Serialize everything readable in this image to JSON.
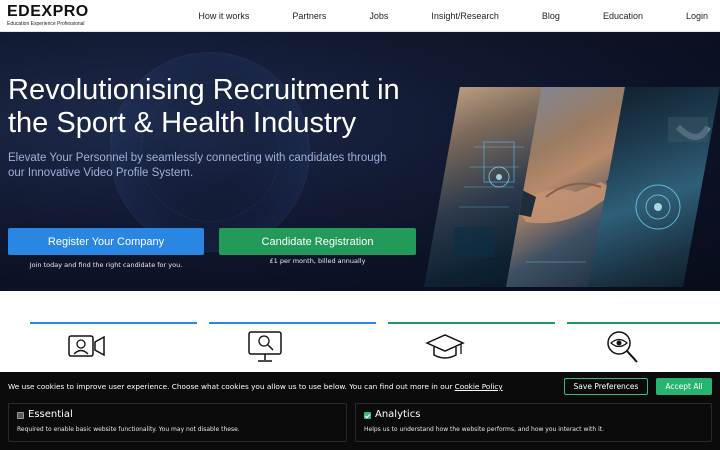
{
  "brand": {
    "logo_text_1": "EDE",
    "logo_text_x": "X",
    "logo_text_2": "PRO",
    "tagline": "Education    Experience    Professional"
  },
  "nav": {
    "items": [
      {
        "label": "How it works"
      },
      {
        "label": "Partners"
      },
      {
        "label": "Jobs"
      },
      {
        "label": "Insight/Research"
      },
      {
        "label": "Blog"
      },
      {
        "label": "Education"
      },
      {
        "label": "Login"
      }
    ]
  },
  "hero": {
    "title": "Revolutionising Recruitment in the Sport & Health Industry",
    "subtitle": "Elevate Your Personnel by seamlessly connecting with candidates through our Innovative Video Profile System.",
    "register_button": "Register Your Company",
    "register_note": "Join today and find the right candidate for you.",
    "candidate_button": "Candidate Registration",
    "candidate_note": "£1 per month, billed annually"
  },
  "features": {
    "icons": [
      "video-camera-icon",
      "monitor-search-icon",
      "graduation-cap-icon",
      "search-eye-icon"
    ],
    "accent_blue": "#2a86e3",
    "accent_green": "#229a5a"
  },
  "cookie": {
    "text": "We use cookies to improve user experience. Choose what cookies you allow us to use below. You can find out more in our ",
    "link": "Cookie Policy",
    "save_label": "Save Preferences",
    "accept_label": "Accept All",
    "essential": {
      "title": "Essential",
      "desc": "Required to enable basic website functionality. You may not disable these."
    },
    "analytics": {
      "title": "Analytics",
      "desc": "Helps us to understand how the website performs, and how you interact with it."
    }
  }
}
